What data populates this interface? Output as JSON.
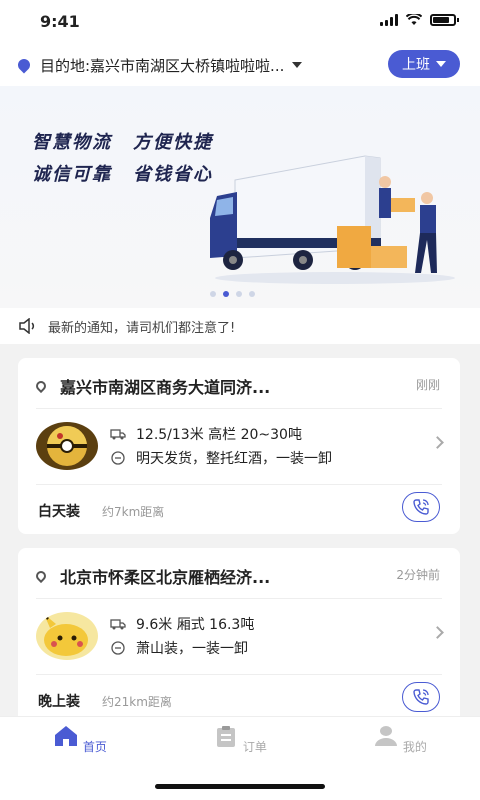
{
  "status_bar": {
    "time": "9:41"
  },
  "top_bar": {
    "destination": "目的地:嘉兴市南湖区大桥镇啦啦啦...",
    "shift_label": "上班",
    "accent": "#4a5bd3"
  },
  "banner": {
    "slogans": [
      "智慧物流",
      "方便快捷",
      "诚信可靠",
      "省钱省心"
    ],
    "page_count": 4,
    "active_page": 2
  },
  "notice": {
    "text": "最新的通知，请司机们都注意了!"
  },
  "orders": [
    {
      "route": "嘉兴市南湖区商务大道同济...",
      "time_ago": "刚刚",
      "spec": "12.5/13米  高栏  20~30吨",
      "note": "明天发货，整托红酒，一装一卸",
      "load_type": "白天装",
      "distance": "约7km距离",
      "thumb_icon": "pokeball-avatar"
    },
    {
      "route": "北京市怀柔区北京雁栖经济...",
      "time_ago": "2分钟前",
      "spec": "9.6米  厢式  16.3吨",
      "note": "萧山装，一装一卸",
      "load_type": "晚上装",
      "distance": "约21km距离",
      "thumb_icon": "pikachu-avatar"
    }
  ],
  "tabs": [
    {
      "label": "首页",
      "icon": "home-icon",
      "active": true
    },
    {
      "label": "订单",
      "icon": "clipboard-icon",
      "active": false
    },
    {
      "label": "我的",
      "icon": "user-icon",
      "active": false
    }
  ]
}
